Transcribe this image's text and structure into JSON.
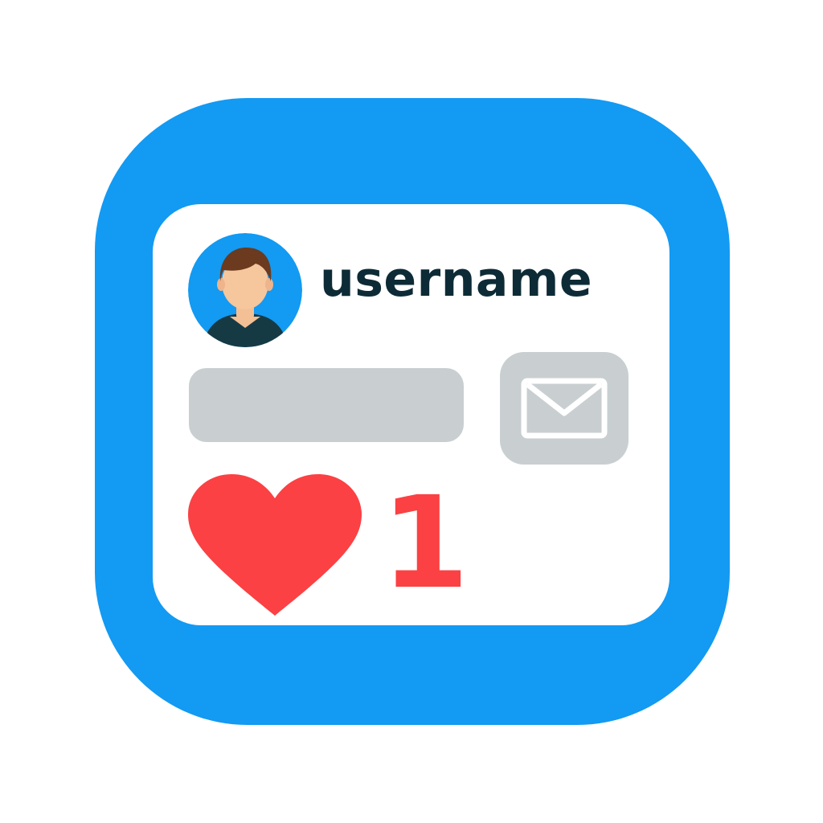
{
  "profile": {
    "username": "username"
  },
  "actions": {
    "mail_icon": "envelope-icon",
    "like_icon": "heart-icon",
    "like_count": "1"
  },
  "colors": {
    "brand": "#139af2",
    "username_text": "#0d2b36",
    "field_gray": "#c9cfd1",
    "heart_red": "#fb4143",
    "avatar_bg": "#139af2"
  }
}
